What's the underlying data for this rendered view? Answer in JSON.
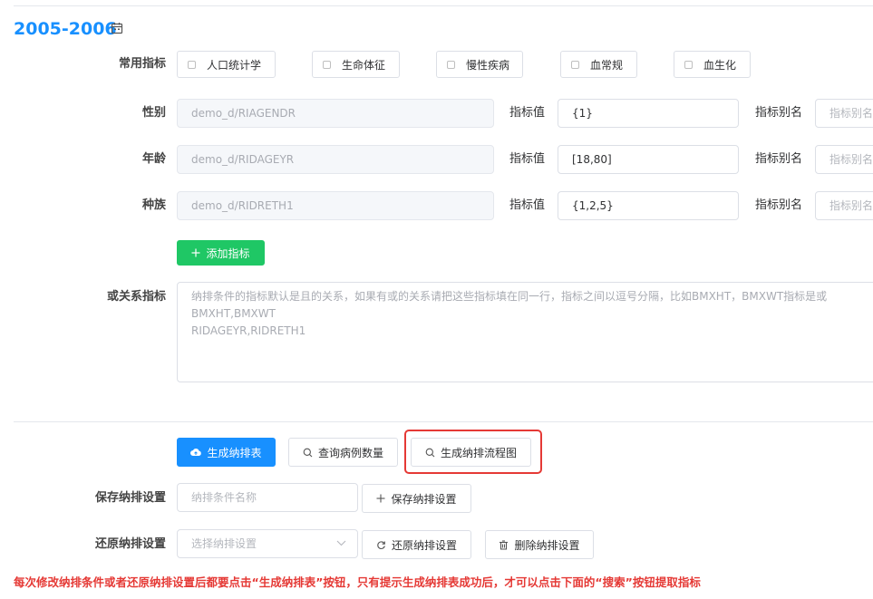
{
  "header": {
    "title": "2005-2006",
    "calendar_icon": "calendar-icon"
  },
  "common_indicators": {
    "label": "常用指标",
    "options": [
      "人口统计学",
      "生命体征",
      "慢性疾病",
      "血常规",
      "血生化"
    ]
  },
  "indicator_rows": [
    {
      "label": "性别",
      "field_value": "demo_d/RIAGENDR",
      "value_label": "指标值",
      "value": "{1}",
      "alias_label": "指标别名",
      "alias_placeholder": "指标别名"
    },
    {
      "label": "年龄",
      "field_value": "demo_d/RIDAGEYR",
      "value_label": "指标值",
      "value": "[18,80]",
      "alias_label": "指标别名",
      "alias_placeholder": "指标别名"
    },
    {
      "label": "种族",
      "field_value": "demo_d/RIDRETH1",
      "value_label": "指标值",
      "value": "{1,2,5}",
      "alias_label": "指标别名",
      "alias_placeholder": "指标别名"
    }
  ],
  "add_indicator_button": "添加指标",
  "or_relation": {
    "label": "或关系指标",
    "placeholder_lines": [
      "纳排条件的指标默认是且的关系，如果有或的关系请把这些指标填在同一行，指标之间以逗号分隔，比如BMXHT，BMXWT指标是或",
      "BMXHT,BMXWT",
      "RIDAGEYR,RIDRETH1"
    ]
  },
  "actions": {
    "generate_table": "生成纳排表",
    "query_case_count": "查询病例数量",
    "generate_flowchart": "生成纳排流程图"
  },
  "save_settings": {
    "label": "保存纳排设置",
    "placeholder": "纳排条件名称",
    "button": "保存纳排设置"
  },
  "restore_settings": {
    "label": "还原纳排设置",
    "placeholder": "选择纳排设置",
    "restore_button": "还原纳排设置",
    "delete_button": "删除纳排设置"
  },
  "warning": "每次修改纳排条件或者还原纳排设置后都要点击“生成纳排表”按钮，只有提示生成纳排表成功后，才可以点击下面的“搜索”按钮提取指标",
  "colors": {
    "accent": "#1890ff",
    "success": "#1fc765",
    "warning_text": "#e53935"
  }
}
